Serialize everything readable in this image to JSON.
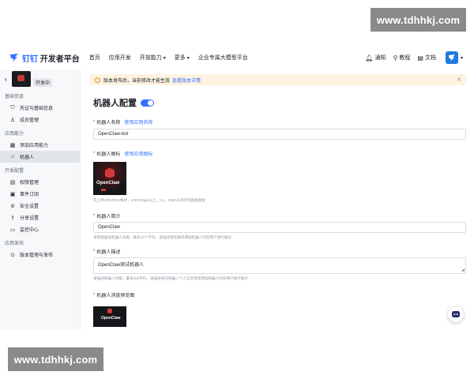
{
  "watermark": {
    "text": "www.tdhhkj.com"
  },
  "topnav": {
    "brand_word": "钉钉",
    "platform": "开发者平台",
    "items": [
      {
        "label": "首页",
        "chev": false
      },
      {
        "label": "应用开发",
        "chev": false
      },
      {
        "label": "开放能力",
        "chev": true
      },
      {
        "label": "更多",
        "chev": true
      },
      {
        "label": "企业专属大模型平台",
        "chev": false
      }
    ],
    "right": {
      "notify": "通知",
      "tutorial": "教程",
      "docs": "文档"
    }
  },
  "sidebar": {
    "app_status": "开发中",
    "sections": [
      {
        "title": "基础信息",
        "items": [
          {
            "label": "凭证与基础信息",
            "icon": "shield-icon",
            "glyph": "⛉"
          },
          {
            "label": "成员管理",
            "icon": "user-icon",
            "glyph": "♙"
          }
        ]
      },
      {
        "title": "应用能力",
        "items": [
          {
            "label": "添加应用能力",
            "icon": "grid-icon",
            "glyph": "▦"
          },
          {
            "label": "机器人",
            "icon": "robot-icon",
            "glyph": "⌂",
            "active": true
          }
        ]
      },
      {
        "title": "开发配置",
        "items": [
          {
            "label": "权限管理",
            "icon": "permission-icon",
            "glyph": "▤"
          },
          {
            "label": "事件订阅",
            "icon": "event-icon",
            "glyph": "▣"
          },
          {
            "label": "安全设置",
            "icon": "security-icon",
            "glyph": "⊘"
          },
          {
            "label": "分享设置",
            "icon": "share-icon",
            "glyph": "⇪"
          },
          {
            "label": "监控中心",
            "icon": "monitor-icon",
            "glyph": "▭"
          }
        ]
      },
      {
        "title": "应用发布",
        "items": [
          {
            "label": "版本管理与发布",
            "icon": "version-icon",
            "glyph": "⊙"
          }
        ]
      }
    ]
  },
  "main": {
    "notice": {
      "text": "版本发布后，当前修改才能生效",
      "link": "查看版本详情"
    },
    "title": "机器人配置",
    "name": {
      "label": "机器人名称",
      "use": "使用应用名称",
      "value": "OpenClaw-bot"
    },
    "icon": {
      "label": "机器人图标",
      "use": "使用应用图标",
      "hint": "可上传JPG/PNG格式，240*240px以上，1:1，2MB 以内的无圆角图标",
      "brand": "OpenClaw"
    },
    "intro": {
      "label": "机器人简介",
      "value": "OpenClaw",
      "hint": "请简要描述机器人功能，最多10个字符，该描述将在群内添加机器人时向用户进行展示"
    },
    "desc": {
      "label": "机器人描述",
      "value": "OpenClaw测试机器人",
      "hint": "请描述机器人功能，最多200字符，该描述将在机器人个人信息页和添加机器人时向用户进行展示"
    },
    "preview": {
      "label": "机器人消息预览图",
      "brand": "OpenClaw"
    }
  }
}
